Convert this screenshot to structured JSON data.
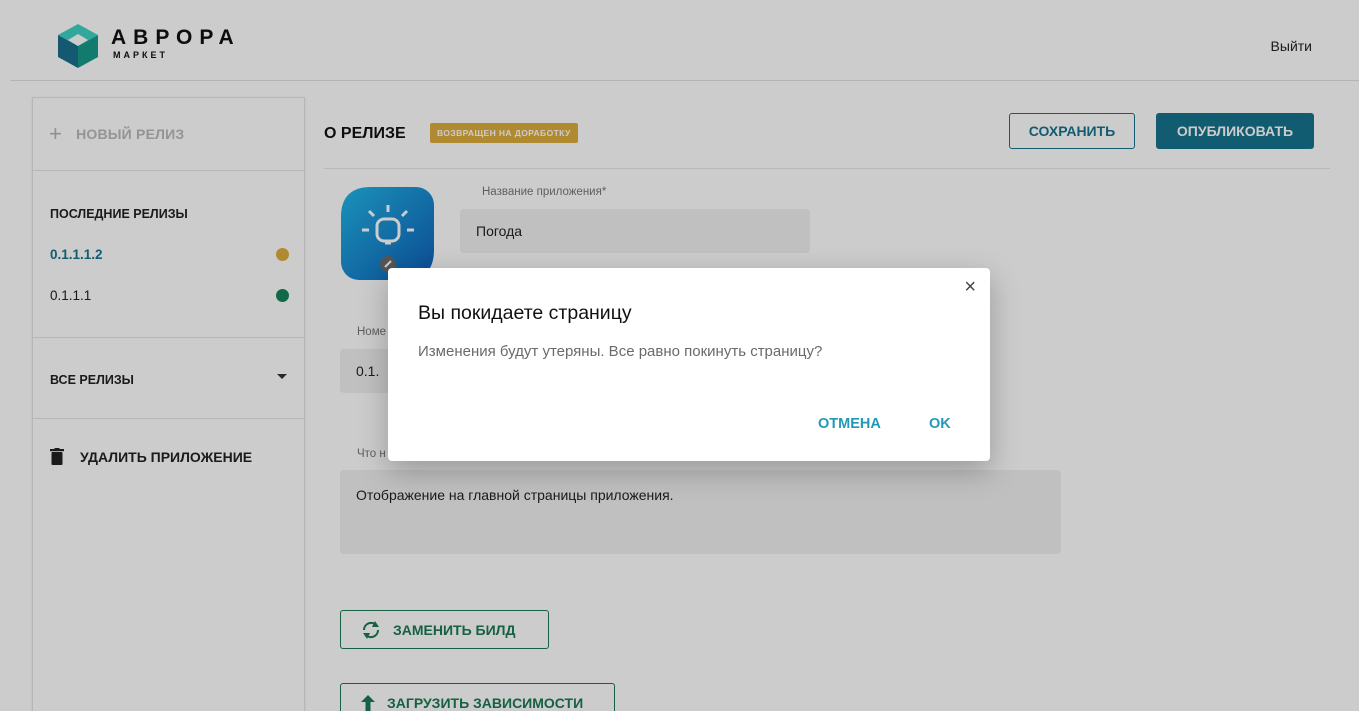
{
  "header": {
    "brand_title": "АВРОРА",
    "brand_subtitle": "МАРКЕТ",
    "logout_label": "Выйти"
  },
  "sidebar": {
    "new_release_label": "НОВЫЙ РЕЛИЗ",
    "recent_heading": "ПОСЛЕДНИЕ РЕЛИЗЫ",
    "releases": [
      {
        "version": "0.1.1.1.2",
        "status_color": "#dcad3e"
      },
      {
        "version": "0.1.1.1",
        "status_color": "#16845a"
      }
    ],
    "all_releases_label": "ВСЕ РЕЛИЗЫ",
    "delete_app_label": "УДАЛИТЬ ПРИЛОЖЕНИЕ"
  },
  "main": {
    "title": "О РЕЛИЗЕ",
    "status_badge": "ВОЗВРАЩЕН НА ДОРАБОТКУ",
    "save_label": "СОХРАНИТЬ",
    "publish_label": "ОПУБЛИКОВАТЬ",
    "app_name_label": "Название приложения*",
    "app_name_value": "Погода",
    "version_label_partial": "Номе",
    "version_value_partial": "0.1.",
    "whats_new_label_partial": "Что н",
    "whats_new_value": "Отображение на главной страницы приложения.",
    "replace_build_label": "ЗАМЕНИТЬ БИЛД",
    "upload_deps_label": "ЗАГРУЗИТЬ ЗАВИСИМОСТИ"
  },
  "dialog": {
    "title": "Вы покидаете страницу",
    "message": "Изменения будут утеряны. Все равно покинуть страницу?",
    "close_glyph": "×",
    "cancel_label": "ОТМЕНА",
    "ok_label": "OK"
  },
  "colors": {
    "primary": "#17748e",
    "accent_link": "#2299b8",
    "badge": "#dcad3e",
    "green": "#1b7a52"
  }
}
